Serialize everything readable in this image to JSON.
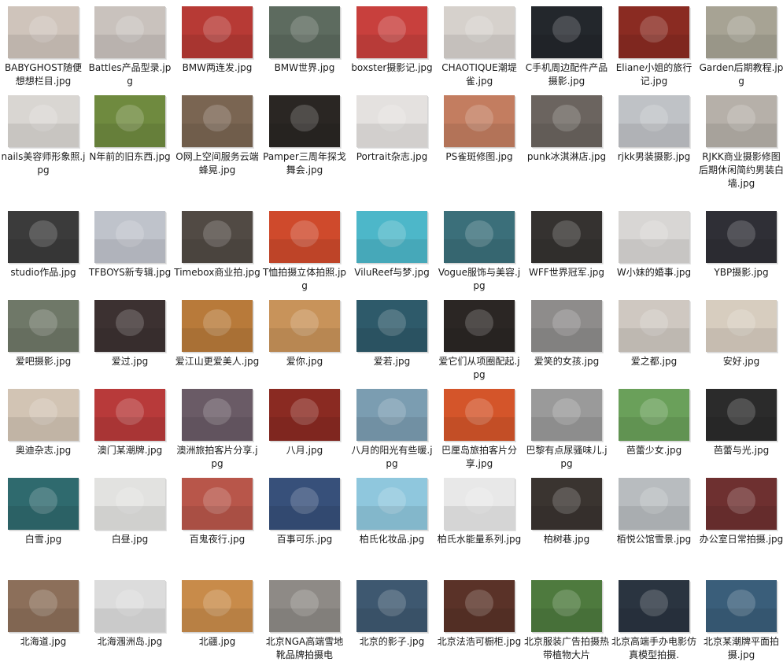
{
  "files": [
    {
      "name": "BABYGHOST随便想想栏目.jpg",
      "color": "#cfc4bb"
    },
    {
      "name": "Battles产品型录.jpg",
      "color": "#c9c2bd"
    },
    {
      "name": "BMW两连发.jpg",
      "color": "#b73a35"
    },
    {
      "name": "BMW世界.jpg",
      "color": "#5d6b5f"
    },
    {
      "name": "boxster摄影记.jpg",
      "color": "#c8403d"
    },
    {
      "name": "CHAOTIQUE潮堤雀.jpg",
      "color": "#d6d1cc"
    },
    {
      "name": "C手机周边配件产品摄影.jpg",
      "color": "#23272c"
    },
    {
      "name": "Eliane小姐的旅行记.jpg",
      "color": "#8a2b22"
    },
    {
      "name": "Garden后期教程.jpg",
      "color": "#a7a394"
    },
    {
      "name": "nails美容师形象照.jpg",
      "color": "#d9d6d2"
    },
    {
      "name": "N年前的旧东西.jpg",
      "color": "#6f8a3f"
    },
    {
      "name": "O网上空间服务云端蜂晃.jpg",
      "color": "#7a6552"
    },
    {
      "name": "Pamper三周年探戈舞会.jpg",
      "color": "#2a2623"
    },
    {
      "name": "Portrait杂志.jpg",
      "color": "#e4e1df"
    },
    {
      "name": "PS雀斑修图.jpg",
      "color": "#c37d60"
    },
    {
      "name": "punk冰淇淋店.jpg",
      "color": "#6b645f"
    },
    {
      "name": "rjkk男装摄影.jpg",
      "color": "#bfc2c6"
    },
    {
      "name": "RJKK商业摄影修图后期休闲简约男装白墙.jpg",
      "color": "#b6b0a9"
    },
    {
      "name": "studio作品.jpg",
      "color": "#3b3b3b"
    },
    {
      "name": "TFBOYS新专辑.jpg",
      "color": "#bfc3cb"
    },
    {
      "name": "Timebox商业拍.jpg",
      "color": "#514a44"
    },
    {
      "name": "T恤拍摄立体拍照.jpg",
      "color": "#cf4a2c"
    },
    {
      "name": "ViluReef与梦.jpg",
      "color": "#4db7c9"
    },
    {
      "name": "Vogue服饰与美容.jpg",
      "color": "#3b6f7a"
    },
    {
      "name": "WFF世界冠军.jpg",
      "color": "#353230"
    },
    {
      "name": "W小妹的婚事.jpg",
      "color": "#d8d6d4"
    },
    {
      "name": "YBP摄影.jpg",
      "color": "#2f2f36"
    },
    {
      "name": "爱吧摄影.jpg",
      "color": "#6f7868"
    },
    {
      "name": "爱过.jpg",
      "color": "#3c3131"
    },
    {
      "name": "爱江山更爱美人.jpg",
      "color": "#b87a3a"
    },
    {
      "name": "爱你.jpg",
      "color": "#c8935a"
    },
    {
      "name": "爱若.jpg",
      "color": "#2e5a6a"
    },
    {
      "name": "爱它们从项圈配起.jpg",
      "color": "#2b2624"
    },
    {
      "name": "爱笑的女孩.jpg",
      "color": "#8e8c8b"
    },
    {
      "name": "爱之都.jpg",
      "color": "#cfc8c1"
    },
    {
      "name": "安好.jpg",
      "color": "#d7cdbf"
    },
    {
      "name": "奥迪杂志.jpg",
      "color": "#d2c4b4"
    },
    {
      "name": "澳门某潮牌.jpg",
      "color": "#b83a3a"
    },
    {
      "name": "澳洲旅拍客片分享.jpg",
      "color": "#6a5b66"
    },
    {
      "name": "八月.jpg",
      "color": "#8a2a22"
    },
    {
      "name": "八月的阳光有些暖.jpg",
      "color": "#7b9db1"
    },
    {
      "name": "巴厘岛旅拍客片分享.jpg",
      "color": "#d4552a"
    },
    {
      "name": "巴黎有点尿骚味儿.jpg",
      "color": "#9a9a9a"
    },
    {
      "name": "芭蕾少女.jpg",
      "color": "#6aa05a"
    },
    {
      "name": "芭蕾与光.jpg",
      "color": "#2b2b2b"
    },
    {
      "name": "白雪.jpg",
      "color": "#2f6a6e"
    },
    {
      "name": "白昼.jpg",
      "color": "#e2e2e0"
    },
    {
      "name": "百鬼夜行.jpg",
      "color": "#b8564a"
    },
    {
      "name": "百事可乐.jpg",
      "color": "#37507a"
    },
    {
      "name": "柏氏化妆品.jpg",
      "color": "#8fc7dd"
    },
    {
      "name": "柏氏水能量系列.jpg",
      "color": "#e8e8e8"
    },
    {
      "name": "柏树巷.jpg",
      "color": "#3a3430"
    },
    {
      "name": "栢悦公馆雪景.jpg",
      "color": "#b8bcbf"
    },
    {
      "name": "办公室日常拍摄.jpg",
      "color": "#6e3030"
    },
    {
      "name": "北海道.jpg",
      "color": "#8c6f5a"
    },
    {
      "name": "北海涠洲岛.jpg",
      "color": "#dcdcdc"
    },
    {
      "name": "北疆.jpg",
      "color": "#c88b4a"
    },
    {
      "name": "北京NGA高端雪地靴品牌拍摄电",
      "color": "#8e8a86"
    },
    {
      "name": "北京的影子.jpg",
      "color": "#3e5870"
    },
    {
      "name": "北京法浩可橱柜.jpg",
      "color": "#5a3228"
    },
    {
      "name": "北京服装广告拍摄热带植物大片",
      "color": "#4e7a3e"
    },
    {
      "name": "北京高端手办电影仿真模型拍摄.",
      "color": "#2a3440"
    },
    {
      "name": "北京某潮牌平面拍摄.jpg",
      "color": "#3a5e7a"
    }
  ]
}
